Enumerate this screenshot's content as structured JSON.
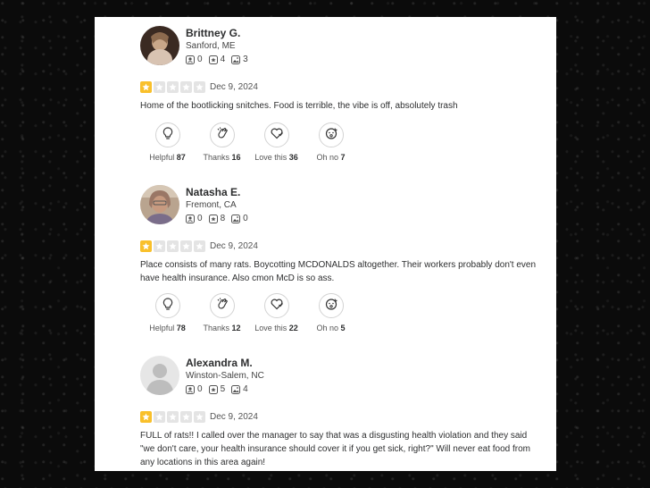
{
  "reviews": [
    {
      "name": "Brittney G.",
      "location": "Sanford, ME",
      "stats": {
        "friends": "0",
        "reviews": "4",
        "photos": "3"
      },
      "rating": 1,
      "date": "Dec 9, 2024",
      "text": "Home of the bootlicking snitches. Food is terrible, the vibe is off, absolutely trash",
      "reactions": {
        "helpful": "87",
        "thanks": "16",
        "love_this": "36",
        "oh_no": "7"
      }
    },
    {
      "name": "Natasha E.",
      "location": "Fremont, CA",
      "stats": {
        "friends": "0",
        "reviews": "8",
        "photos": "0"
      },
      "rating": 1,
      "date": "Dec 9, 2024",
      "text": "Place consists of many rats. Boycotting MCDONALDS altogether. Their workers probably don't even have health insurance. Also cmon McD is so ass.",
      "reactions": {
        "helpful": "78",
        "thanks": "12",
        "love_this": "22",
        "oh_no": "5"
      }
    },
    {
      "name": "Alexandra M.",
      "location": "Winston-Salem, NC",
      "stats": {
        "friends": "0",
        "reviews": "5",
        "photos": "4"
      },
      "rating": 1,
      "date": "Dec 9, 2024",
      "text": "FULL of rats!! I called over the manager to say that was a disgusting health violation and they said \"we don't care, your health insurance should cover it if you get sick, right?\" Will never eat food from any locations in this area again!"
    }
  ],
  "labels": {
    "helpful": "Helpful",
    "thanks": "Thanks",
    "love_this": "Love this",
    "oh_no": "Oh no"
  },
  "colors": {
    "star_filled": "#f9c02b",
    "star_empty": "#e4e4e4",
    "text": "#2d2e2f"
  }
}
